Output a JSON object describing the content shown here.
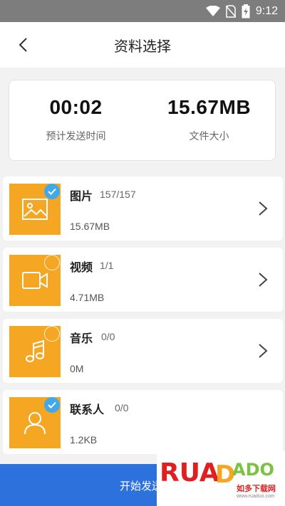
{
  "status_bar": {
    "time": "9:12"
  },
  "header": {
    "title": "资料选择"
  },
  "summary": {
    "duration_value": "00:02",
    "duration_label": "预计发送时间",
    "size_value": "15.67MB",
    "size_label": "文件大小"
  },
  "categories": [
    {
      "name": "图片",
      "count": "157/157",
      "size": "15.67MB",
      "selected": true,
      "icon": "image-icon"
    },
    {
      "name": "视频",
      "count": "1/1",
      "size": "4.71MB",
      "selected": false,
      "icon": "video-icon"
    },
    {
      "name": "音乐",
      "count": "0/0",
      "size": "0M",
      "selected": false,
      "icon": "music-icon"
    },
    {
      "name": "联系人",
      "count": "0/0",
      "size": "1.2KB",
      "selected": true,
      "icon": "contact-icon"
    }
  ],
  "footer": {
    "start_label": "开始发送"
  },
  "watermark": {
    "brand": "RUANDADO",
    "sub": "如多下载网",
    "url": "www.ruaduo.com"
  },
  "colors": {
    "accent": "#2d72dc",
    "thumb": "#f5a623",
    "check": "#41a8ec"
  }
}
